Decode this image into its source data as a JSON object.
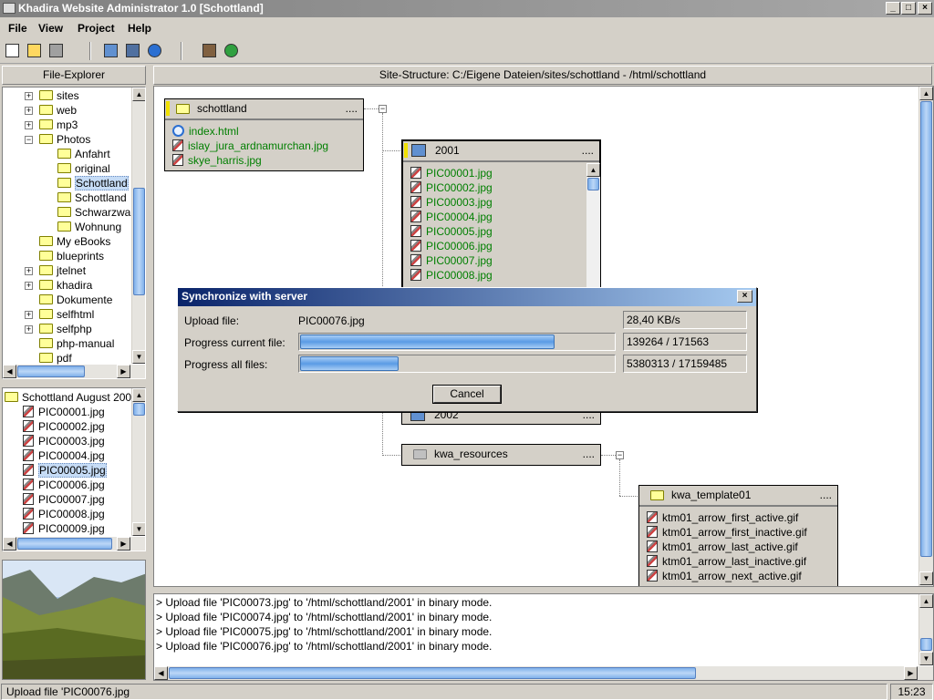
{
  "window": {
    "title": "Khadira Website Administrator 1.0 [Schottland]"
  },
  "menu": [
    "File",
    "View",
    "Project",
    "Help"
  ],
  "file_explorer": {
    "header": "File-Explorer",
    "tree": [
      {
        "label": "sites",
        "exp": "+",
        "indent": 1
      },
      {
        "label": "web",
        "exp": "+",
        "indent": 1
      },
      {
        "label": "mp3",
        "exp": "+",
        "indent": 1
      },
      {
        "label": "Photos",
        "exp": "-",
        "indent": 1
      },
      {
        "label": "Anfahrt",
        "exp": "",
        "indent": 2
      },
      {
        "label": "original",
        "exp": "",
        "indent": 2
      },
      {
        "label": "Schottland",
        "exp": "",
        "indent": 2,
        "selected": true
      },
      {
        "label": "Schottland",
        "exp": "",
        "indent": 2
      },
      {
        "label": "Schwarzwa",
        "exp": "",
        "indent": 2
      },
      {
        "label": "Wohnung",
        "exp": "",
        "indent": 2
      },
      {
        "label": "My eBooks",
        "exp": "",
        "indent": 1
      },
      {
        "label": "blueprints",
        "exp": "",
        "indent": 1
      },
      {
        "label": "jtelnet",
        "exp": "+",
        "indent": 1
      },
      {
        "label": "khadira",
        "exp": "+",
        "indent": 1
      },
      {
        "label": "Dokumente",
        "exp": "",
        "indent": 1
      },
      {
        "label": "selfhtml",
        "exp": "+",
        "indent": 1
      },
      {
        "label": "selfphp",
        "exp": "+",
        "indent": 1
      },
      {
        "label": "php-manual",
        "exp": "",
        "indent": 1
      },
      {
        "label": "pdf",
        "exp": "",
        "indent": 1
      }
    ]
  },
  "folder_list": {
    "title": "Schottland August 200",
    "files": [
      "PIC00001.jpg",
      "PIC00002.jpg",
      "PIC00003.jpg",
      "PIC00004.jpg",
      "PIC00005.jpg",
      "PIC00006.jpg",
      "PIC00007.jpg",
      "PIC00008.jpg",
      "PIC00009.jpg"
    ],
    "selected_index": 4
  },
  "site_structure": {
    "header": "Site-Structure:    C:/Eigene Dateien/sites/schottland    -    /html/schottland",
    "root": {
      "title": "schottland",
      "dots": "....",
      "files": [
        "index.html",
        "islay_jura_ardnamurchan.jpg",
        "skye_harris.jpg"
      ]
    },
    "n2001": {
      "title": "2001",
      "dots": "....",
      "files": [
        "PIC00001.jpg",
        "PIC00002.jpg",
        "PIC00003.jpg",
        "PIC00004.jpg",
        "PIC00005.jpg",
        "PIC00006.jpg",
        "PIC00007.jpg",
        "PIC00008.jpg"
      ]
    },
    "n2002": {
      "title": "2002",
      "dots": "...."
    },
    "kwa_resources": {
      "title": "kwa_resources",
      "dots": "...."
    },
    "kwa_template": {
      "title": "kwa_template01",
      "dots": "....",
      "files": [
        "ktm01_arrow_first_active.gif",
        "ktm01_arrow_first_inactive.gif",
        "ktm01_arrow_last_active.gif",
        "ktm01_arrow_last_inactive.gif",
        "ktm01_arrow_next_active.gif"
      ]
    }
  },
  "dialog": {
    "title": "Synchronize with server",
    "upload_label": "Upload file:",
    "upload_file": "PIC00076.jpg",
    "speed": "28,40 KB/s",
    "current_label": "Progress current file:",
    "current_value": "139264 / 171563",
    "current_fraction": 0.812,
    "all_label": "Progress all files:",
    "all_value": "5380313 / 17159485",
    "all_fraction": 0.314,
    "cancel": "Cancel"
  },
  "log": [
    "> Upload file 'PIC00073.jpg' to '/html/schottland/2001' in binary mode.",
    "> Upload file 'PIC00074.jpg' to '/html/schottland/2001' in binary mode.",
    "> Upload file 'PIC00075.jpg' to '/html/schottland/2001' in binary mode.",
    "> Upload file 'PIC00076.jpg' to '/html/schottland/2001' in binary mode."
  ],
  "status": {
    "text": "Upload file 'PIC00076.jpg",
    "time": "15:23"
  }
}
